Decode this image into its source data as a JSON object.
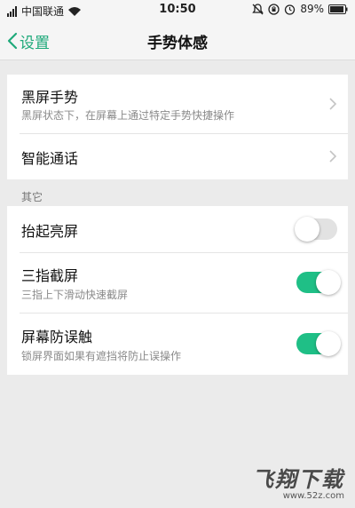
{
  "status_bar": {
    "carrier": "中国联通",
    "time": "10:50",
    "battery_percent": "89%"
  },
  "nav": {
    "back_label": "设置",
    "title": "手势体感"
  },
  "group1": {
    "items": [
      {
        "title": "黑屏手势",
        "subtitle": "黑屏状态下，在屏幕上通过特定手势快捷操作"
      },
      {
        "title": "智能通话"
      }
    ]
  },
  "section_label": "其它",
  "group2": {
    "items": [
      {
        "title": "抬起亮屏",
        "toggle_on": false
      },
      {
        "title": "三指截屏",
        "subtitle": "三指上下滑动快速截屏",
        "toggle_on": true
      },
      {
        "title": "屏幕防误触",
        "subtitle": "锁屏界面如果有遮挡将防止误操作",
        "toggle_on": true
      }
    ]
  },
  "watermark": {
    "logo": "飞翔下载",
    "url": "www.52z.com"
  },
  "colors": {
    "accent": "#1fa97a",
    "toggle_on": "#1fbf86",
    "toggle_off": "#e2e2e2"
  }
}
